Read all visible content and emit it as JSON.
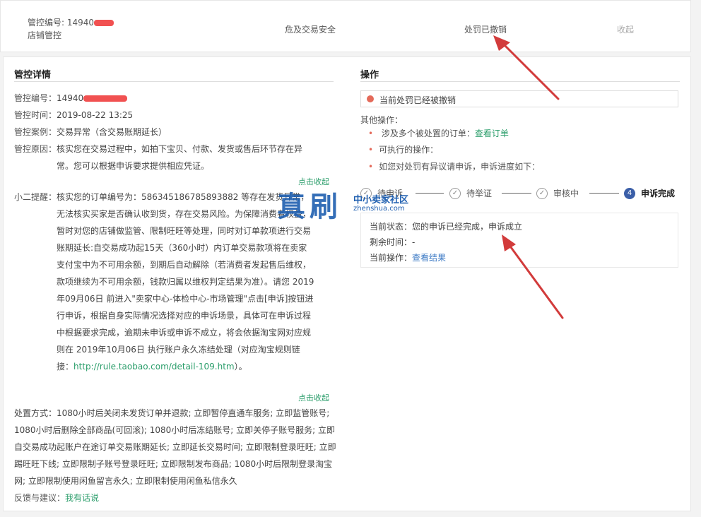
{
  "top": {
    "id_label": "管控编号: 14940",
    "type": "店铺管控",
    "reason": "危及交易安全",
    "status": "处罚已撤销",
    "collapse": "收起"
  },
  "details": {
    "title": "管控详情",
    "id_label": "管控编号：",
    "id_value": "14940",
    "time_label": "管控时间：",
    "time_value": "2019-08-22 13:25",
    "case_label": "管控案例：",
    "case_value": "交易异常（含交易账期延长）",
    "reason_label": "管控原因：",
    "reason_value": "核实您在交易过程中，如拍下宝贝、付款、发货或售后环节存在异常。您可以根据申诉要求提供相应凭证。",
    "toggle1": "点击收起",
    "reminder_label": "小二提醒：",
    "reminder_value": "核实您的订单编号为：586345186785893882 等存在发货异常，无法核实买家是否确认收到货，存在交易风险。为保障消费者权益，暂时对您的店铺做监管、限制旺旺等处理，同时对订单款项进行交易账期延长:自交易成功起15天（360小时）内订单交易款项将在卖家支付宝中为不可用余额，到期后自动解除（若消费者发起售后维权，款项继续为不可用余额，钱款归属以维权判定结果为准）。请您 2019年09月06日 前进入\"卖家中心-体检中心-市场管理\"点击[申诉]按钮进行申诉，根据自身实际情况选择对应的申诉场景，具体可在申诉过程中根据要求完成，逾期未申诉或申诉不成立，将会依据淘宝网对应规则在 2019年10月06日 执行账户永久冻结处理（对应淘宝规则链接：",
    "rule_link": "http://rule.taobao.com/detail-109.htm",
    "reminder_end": "）。",
    "toggle2": "点击收起",
    "measures_label": "处置方式：",
    "measures_value": "1080小时后关闭未发货订单并退款; 立即暂停直通车服务; 立即监管账号; 1080小时后删除全部商品(可回滚); 1080小时后冻结账号; 立即关停子账号服务; 立即自交易成功起账户在途订单交易账期延长; 立即延长交易时间; 立即限制登录旺旺; 立即踢旺旺下线; 立即限制子账号登录旺旺; 立即限制发布商品; 1080小时后限制登录淘宝网; 立即限制使用闲鱼留言永久; 立即限制使用闲鱼私信永久",
    "feedback_label": "反馈与建议：",
    "feedback_link": "我有话说"
  },
  "actions": {
    "title": "操作",
    "alert": "当前处罚已经被撤销",
    "other_label": "其他操作：",
    "bullet1_text": "涉及多个被处置的订单：",
    "bullet1_link": "查看订单",
    "bullet2": "可执行的操作：",
    "bullet3": "如您对处罚有异议请申诉，申诉进度如下：",
    "steps": [
      {
        "label": "待申诉",
        "num": "✓"
      },
      {
        "label": "待举证",
        "num": "✓"
      },
      {
        "label": "审核中",
        "num": "✓"
      },
      {
        "label": "申诉完成",
        "num": "4"
      }
    ],
    "status_line": "当前状态：您的申诉已经完成，申诉成立",
    "remaining": "剩余时间：-",
    "op_label": "当前操作：",
    "op_link": "查看结果"
  },
  "watermark": {
    "big": "真刷",
    "small": "中小卖家社区",
    "domain": "zhenshua.com"
  },
  "colors": {
    "accent_green": "#2a9d6a",
    "accent_blue": "#3b5fa8",
    "alert_red": "#e46a5a",
    "annotation_red": "#d23b3b"
  }
}
